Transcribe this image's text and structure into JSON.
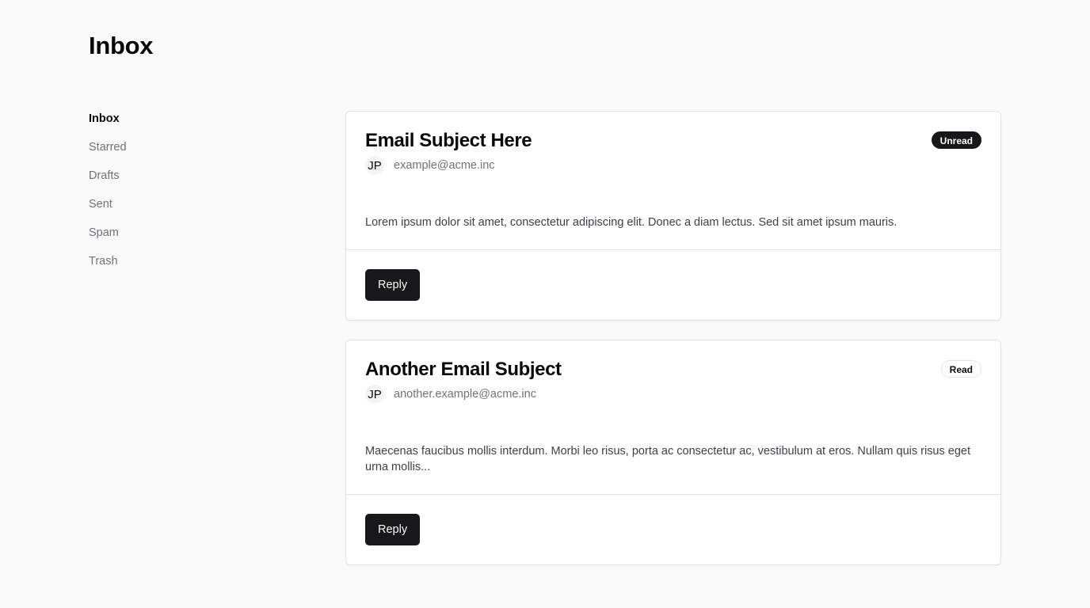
{
  "header": {
    "title": "Inbox"
  },
  "sidebar": {
    "items": [
      {
        "label": "Inbox"
      },
      {
        "label": "Starred"
      },
      {
        "label": "Drafts"
      },
      {
        "label": "Sent"
      },
      {
        "label": "Spam"
      },
      {
        "label": "Trash"
      }
    ]
  },
  "emails": [
    {
      "subject": "Email Subject Here",
      "status": "Unread",
      "avatar_initials": "JP",
      "sender_email": "example@acme.inc",
      "body": "Lorem ipsum dolor sit amet, consectetur adipiscing elit. Donec a diam lectus. Sed sit amet ipsum mauris.",
      "reply_label": "Reply"
    },
    {
      "subject": "Another Email Subject",
      "status": "Read",
      "avatar_initials": "JP",
      "sender_email": "another.example@acme.inc",
      "body": "Maecenas faucibus mollis interdum. Morbi leo risus, porta ac consectetur ac, vestibulum at eros. Nullam quis risus eget urna mollis...",
      "reply_label": "Reply"
    }
  ],
  "colors": {
    "background": "#fafafa",
    "primary": "#18181b",
    "muted_text": "#71717a",
    "border": "#e4e4e7"
  }
}
